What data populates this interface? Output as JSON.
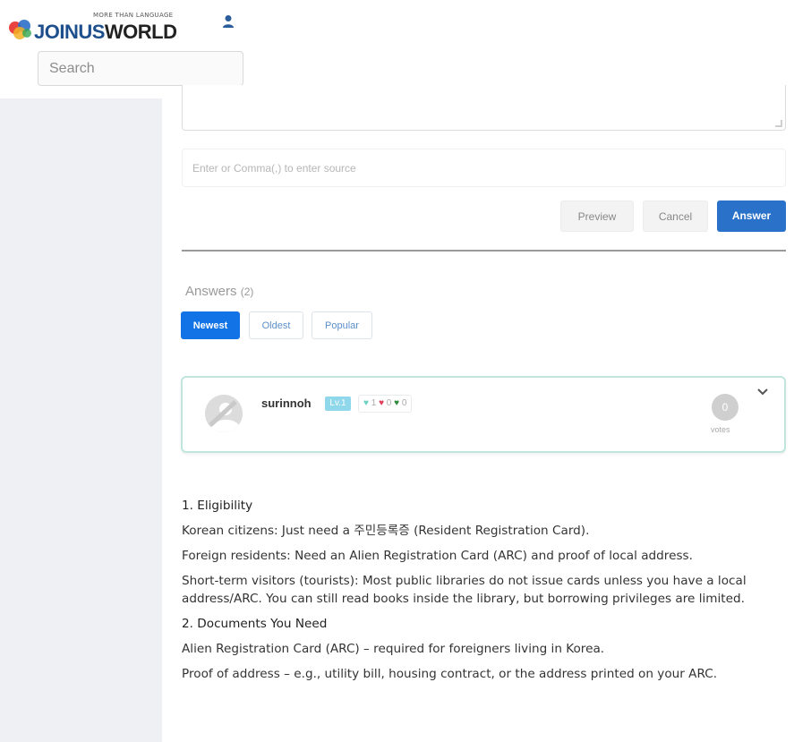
{
  "header": {
    "logo_tagline": "MORE THAN LANGUAGE",
    "logo_part1": "JOINUS",
    "logo_part2": "WORLD",
    "search_placeholder": "Search"
  },
  "editor": {
    "source_placeholder": "Enter or Comma(,) to enter source",
    "preview_label": "Preview",
    "cancel_label": "Cancel",
    "answer_label": "Answer"
  },
  "answers": {
    "title": "Answers",
    "count": "(2)",
    "tabs": [
      {
        "label": "Newest",
        "active": true
      },
      {
        "label": "Oldest",
        "active": false
      },
      {
        "label": "Popular",
        "active": false
      }
    ]
  },
  "answer_card": {
    "author": "surinnoh",
    "level": "Lv.1",
    "reactions": [
      {
        "icon": "heart-teal",
        "color": "#6bd1c1",
        "count": "1"
      },
      {
        "icon": "heart-red",
        "color": "#e23b57",
        "count": "0"
      },
      {
        "icon": "heart-green",
        "color": "#2d8a3a",
        "count": "0"
      }
    ],
    "votes": "0",
    "votes_label": "votes"
  },
  "content": {
    "h1": "1. Eligibility",
    "p1": "Korean citizens: Just need a 주민등록증 (Resident Registration Card).",
    "p2": "Foreign residents: Need an Alien Registration Card (ARC) and proof of local address.",
    "p3": "Short-term visitors (tourists): Most public libraries do not issue cards unless you have a local address/ARC. You can still read books inside the library, but borrowing privileges are limited.",
    "h2": "2. Documents You Need",
    "p4": "Alien Registration Card (ARC) – required for foreigners living in Korea.",
    "p5": "Proof of address – e.g., utility bill, housing contract, or the address printed on your ARC."
  },
  "colors": {
    "primary": "#2a72c9",
    "tab_active": "#1273e6",
    "card_border": "#bfe5dd",
    "sidebar": "#eef0f3"
  }
}
